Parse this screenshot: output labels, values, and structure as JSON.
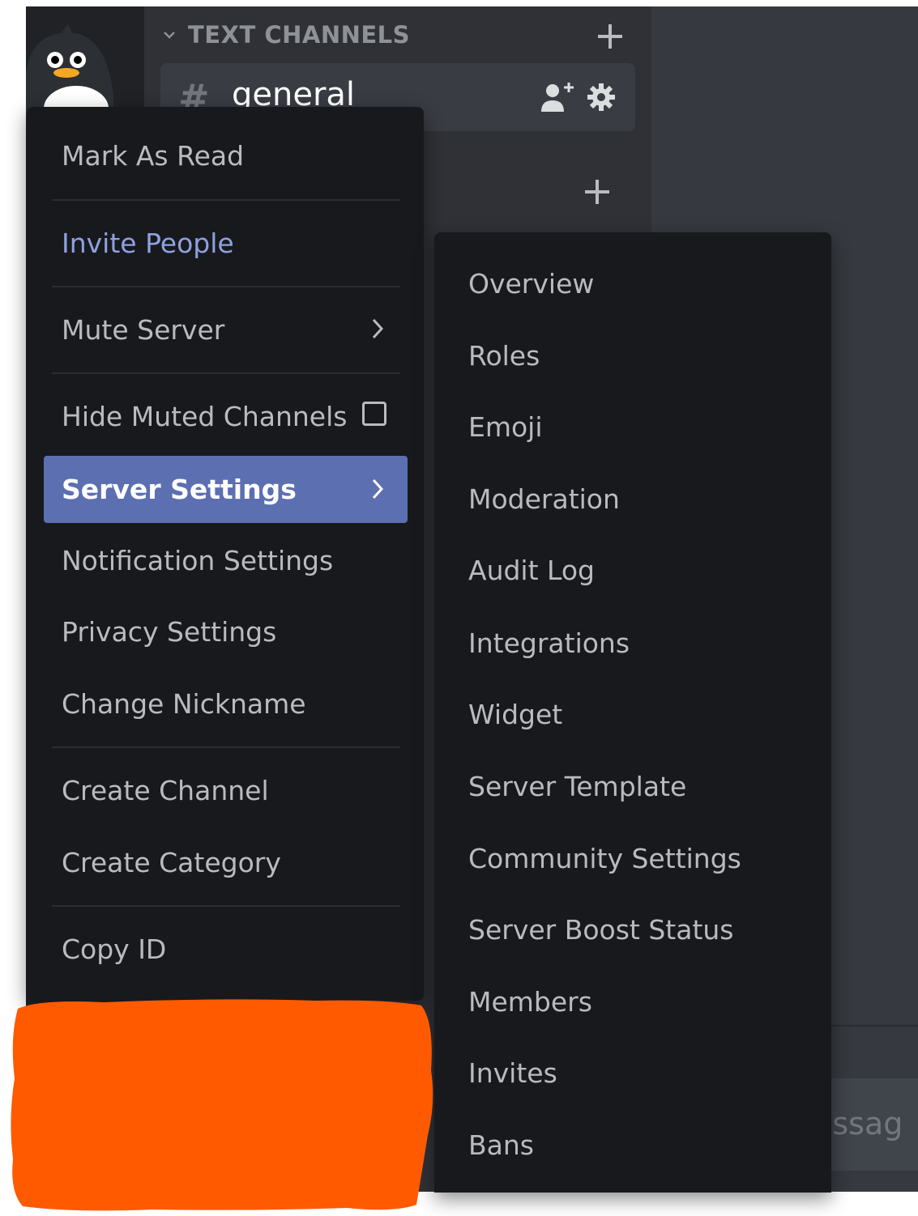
{
  "channels": {
    "category_title": "TEXT CHANNELS",
    "active_channel": {
      "name": "general"
    }
  },
  "server_menu": {
    "items": [
      {
        "label": "Mark As Read"
      },
      {
        "label": "Invite People"
      },
      {
        "label": "Mute Server"
      },
      {
        "label": "Hide Muted Channels"
      },
      {
        "label": "Server Settings"
      },
      {
        "label": "Notification Settings"
      },
      {
        "label": "Privacy Settings"
      },
      {
        "label": "Change Nickname"
      },
      {
        "label": "Create Channel"
      },
      {
        "label": "Create Category"
      },
      {
        "label": "Copy ID"
      }
    ]
  },
  "settings_submenu": {
    "items": [
      {
        "label": "Overview"
      },
      {
        "label": "Roles"
      },
      {
        "label": "Emoji"
      },
      {
        "label": "Moderation"
      },
      {
        "label": "Audit Log"
      },
      {
        "label": "Integrations"
      },
      {
        "label": "Widget"
      },
      {
        "label": "Server Template"
      },
      {
        "label": "Community Settings"
      },
      {
        "label": "Server Boost Status"
      },
      {
        "label": "Members"
      },
      {
        "label": "Invites"
      },
      {
        "label": "Bans"
      }
    ]
  },
  "chat": {
    "message_placeholder_visible": "essag"
  },
  "colors": {
    "accent": "#5c6fb1",
    "brand_text": "#8ea1e1",
    "menu_bg": "#18191c",
    "redaction": "#ff5a00"
  },
  "icons": [
    "penguin-avatar",
    "chevron-down-icon",
    "plus-icon",
    "hash-icon",
    "invite-person-icon",
    "gear-icon",
    "chevron-right-icon",
    "checkbox"
  ]
}
